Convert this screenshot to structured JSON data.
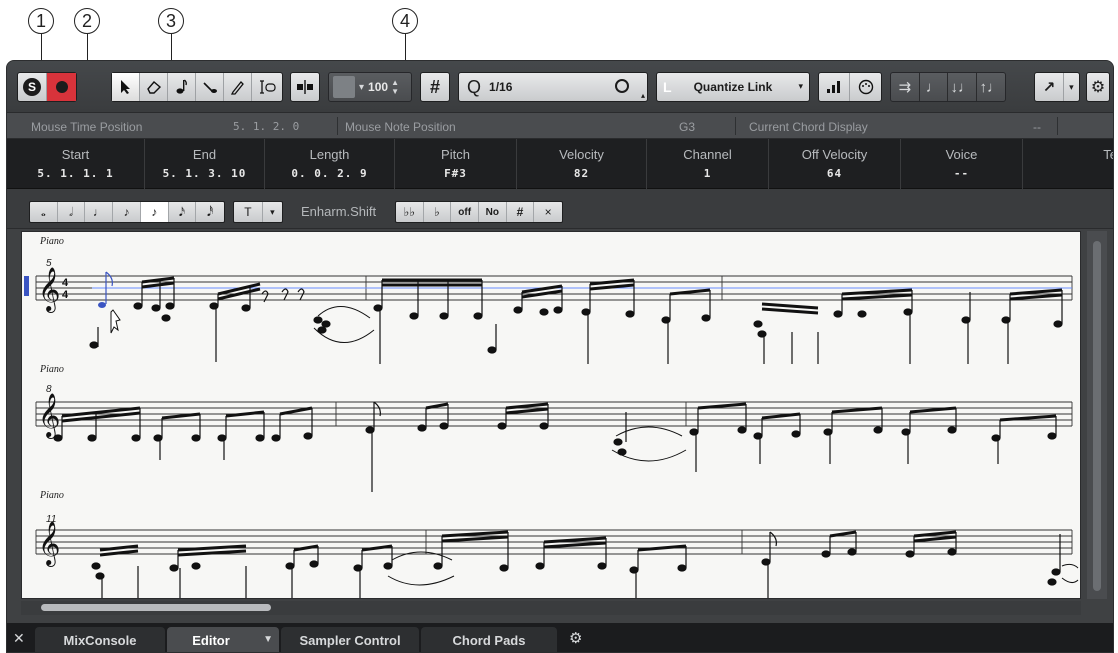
{
  "callouts": [
    "1",
    "2",
    "3",
    "4"
  ],
  "toolbar": {
    "solo_icon": "S",
    "record_icon": "record-dot",
    "tool_icons": [
      "arrow-icon",
      "eraser-icon",
      "note-draw-icon",
      "glue-icon",
      "pencil-icon",
      "text-cursor-icon"
    ],
    "split_icon": "split-icon",
    "velocity_value": "100",
    "grid_icon": "#",
    "quantize_prefix": "Q",
    "quantize_value": "1/16",
    "quantize_link": "Quantize Link",
    "colors": {
      "solo": "#f0f0f0",
      "record": "#e0303a",
      "record_bg": "#cc2a33"
    }
  },
  "infoline": {
    "mouse_time_label": "Mouse Time Position",
    "mouse_time_value": "5. 1. 2.   0",
    "mouse_note_label": "Mouse Note Position",
    "mouse_note_value": "G3",
    "chord_label": "Current Chord Display",
    "chord_value": "--"
  },
  "noteinfo": [
    {
      "label": "Start",
      "value": "5. 1. 1.   1"
    },
    {
      "label": "End",
      "value": "5. 1. 3. 10"
    },
    {
      "label": "Length",
      "value": "0. 0. 2.   9"
    },
    {
      "label": "Pitch",
      "value": "F#3"
    },
    {
      "label": "Velocity",
      "value": "82"
    },
    {
      "label": "Channel",
      "value": "1"
    },
    {
      "label": "Off Velocity",
      "value": "64"
    },
    {
      "label": "Voice",
      "value": "--"
    },
    {
      "label": "Te",
      "value": ""
    }
  ],
  "symbolbar": {
    "note_values": [
      "𝅝",
      "𝅗𝅥",
      "♩",
      "♪",
      "♪",
      "𝅘𝅥𝅯",
      "𝅘𝅥𝅰"
    ],
    "text_button": "T",
    "enharm_label": "Enharm.Shift",
    "enharm_buttons": [
      "♭♭",
      "♭",
      "off",
      "No",
      "#",
      "×"
    ]
  },
  "score": {
    "staves": [
      {
        "instrument": "Piano",
        "bar_number": "5"
      },
      {
        "instrument": "Piano",
        "bar_number": "8"
      },
      {
        "instrument": "Piano",
        "bar_number": "11"
      }
    ]
  },
  "tabs": {
    "close_icon": "✕",
    "items": [
      "MixConsole",
      "Editor",
      "Sampler Control",
      "Chord Pads"
    ],
    "active": "Editor"
  }
}
